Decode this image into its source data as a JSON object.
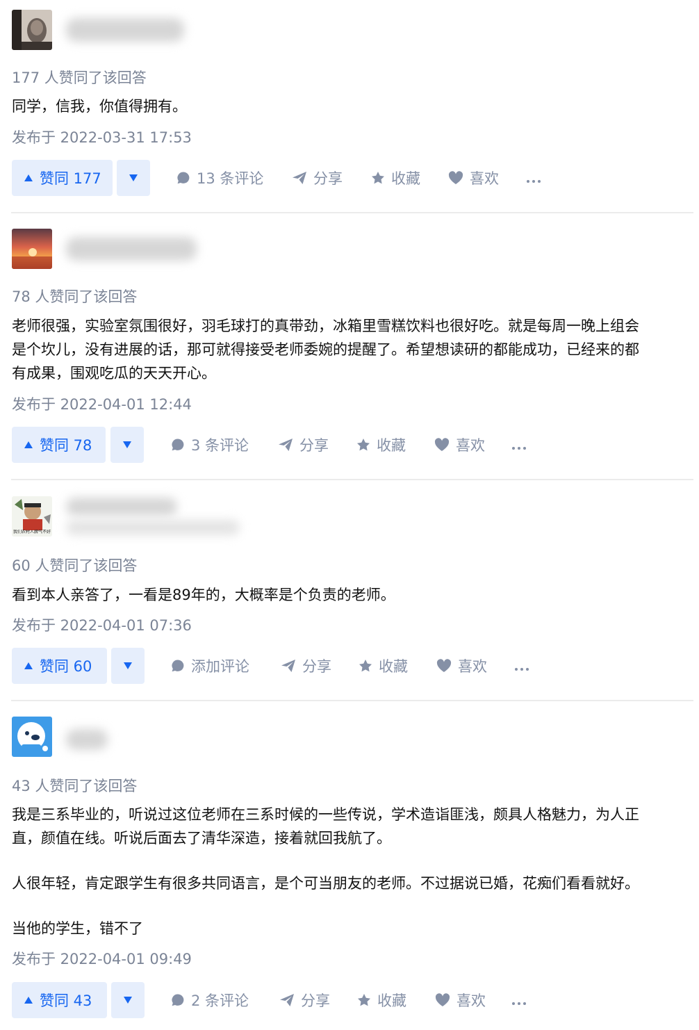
{
  "answers": [
    {
      "votes_text": "177 人赞同了该回答",
      "paragraphs": [
        "同学，信我，你值得拥有。"
      ],
      "time": "发布于 2022-03-31 17:53",
      "vote_label": "赞同 177",
      "comment_label": "13 条评论",
      "share_label": "分享",
      "collect_label": "收藏",
      "like_label": "喜欢"
    },
    {
      "votes_text": "78 人赞同了该回答",
      "paragraphs": [
        "老师很强，实验室氛围很好，羽毛球打的真带劲，冰箱里雪糕饮料也很好吃。就是每周一晚上组会",
        "是个坎儿，没有进展的话，那可就得接受老师委婉的提醒了。希望想读研的都能成功，已经来的都",
        "有成果，围观吃瓜的天天开心。"
      ],
      "time": "发布于 2022-04-01 12:44",
      "vote_label": "赞同 78",
      "comment_label": "3 条评论",
      "share_label": "分享",
      "collect_label": "收藏",
      "like_label": "喜欢"
    },
    {
      "votes_text": "60 人赞同了该回答",
      "paragraphs": [
        "看到本人亲答了，一看是89年的，大概率是个负责的老师。"
      ],
      "time": "发布于 2022-04-01 07:36",
      "vote_label": "赞同 60",
      "comment_label": "添加评论",
      "share_label": "分享",
      "collect_label": "收藏",
      "like_label": "喜欢",
      "avatar_caption": "我们农村人脾气不好"
    },
    {
      "votes_text": "43 人赞同了该回答",
      "paragraphs": [
        "我是三系毕业的，听说过这位老师在三系时候的一些传说，学术造诣匪浅，颇具人格魅力，为人正",
        "直，颜值在线。听说后面去了清华深造，接着就回我航了。",
        "人很年轻，肯定跟学生有很多共同语言，是个可当朋友的老师。不过据说已婚，花痴们看看就好。",
        "当他的学生，错不了"
      ],
      "time": "发布于 2022-04-01 09:49",
      "vote_label": "赞同 43",
      "comment_label": "2 条评论",
      "share_label": "分享",
      "collect_label": "收藏",
      "like_label": "喜欢"
    }
  ],
  "icons": {
    "comment": "comment-bubble-icon",
    "share": "paper-plane-icon",
    "collect": "star-icon",
    "like": "heart-icon",
    "more": "ellipsis-icon"
  },
  "colors": {
    "accent": "#1766f0",
    "vote_bg": "#e6eefc",
    "meta": "#7b8496",
    "action": "#8590a6",
    "divider": "#ebebeb"
  }
}
